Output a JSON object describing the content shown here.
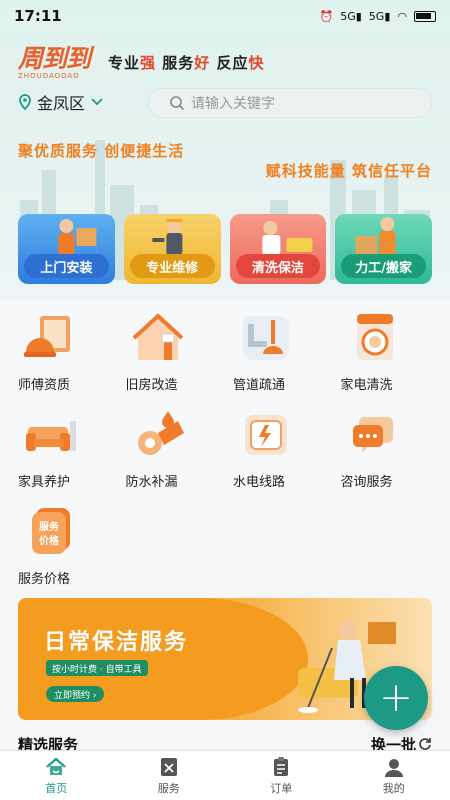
{
  "status_bar": {
    "time": "17:11",
    "network": "5G",
    "network2": "5G"
  },
  "brand": {
    "logo_cn": "周到到",
    "logo_en": "ZHOUDAODAO",
    "slogan_1": "专业",
    "slogan_1_hl": "强",
    "slogan_2": " 服务",
    "slogan_2_hl": "好",
    "slogan_3": " 反应",
    "slogan_3_hl": "快"
  },
  "location": {
    "district": "金凤区"
  },
  "search": {
    "placeholder": "请输入关键字"
  },
  "taglines": {
    "line1": "聚优质服务 创便捷生活",
    "line2": "赋科技能量 筑信任平台"
  },
  "categories": [
    {
      "label": "上门安装",
      "color": "#2d6fd2"
    },
    {
      "label": "专业维修",
      "color": "#e29a14"
    },
    {
      "label": "清洗保洁",
      "color": "#e2463c"
    },
    {
      "label": "力工/搬家",
      "color": "#1b9c78"
    }
  ],
  "services": [
    {
      "label": "师傅资质",
      "icon": "helmet-certificate-icon"
    },
    {
      "label": "旧房改造",
      "icon": "house-brush-icon"
    },
    {
      "label": "管道疏通",
      "icon": "plunger-pipe-icon"
    },
    {
      "label": "家电清洗",
      "icon": "washing-machine-icon"
    },
    {
      "label": "家具养护",
      "icon": "sofa-icon"
    },
    {
      "label": "防水补漏",
      "icon": "waterproof-tape-icon"
    },
    {
      "label": "水电线路",
      "icon": "water-electric-icon"
    },
    {
      "label": "咨询服务",
      "icon": "chat-bubble-icon"
    },
    {
      "label": "服务价格",
      "icon": "price-tag-icon",
      "badge": "服务价格"
    }
  ],
  "banner": {
    "title": "日常保洁服务",
    "subtitle": "按小时计费 · 自带工具",
    "button": "立即预约 ›"
  },
  "section": {
    "title": "精选服务",
    "refresh": "换一批"
  },
  "tabbar": [
    {
      "label": "首页",
      "active": true
    },
    {
      "label": "服务",
      "active": false
    },
    {
      "label": "订单",
      "active": false
    },
    {
      "label": "我的",
      "active": false
    }
  ],
  "accent": "#1d9a86"
}
